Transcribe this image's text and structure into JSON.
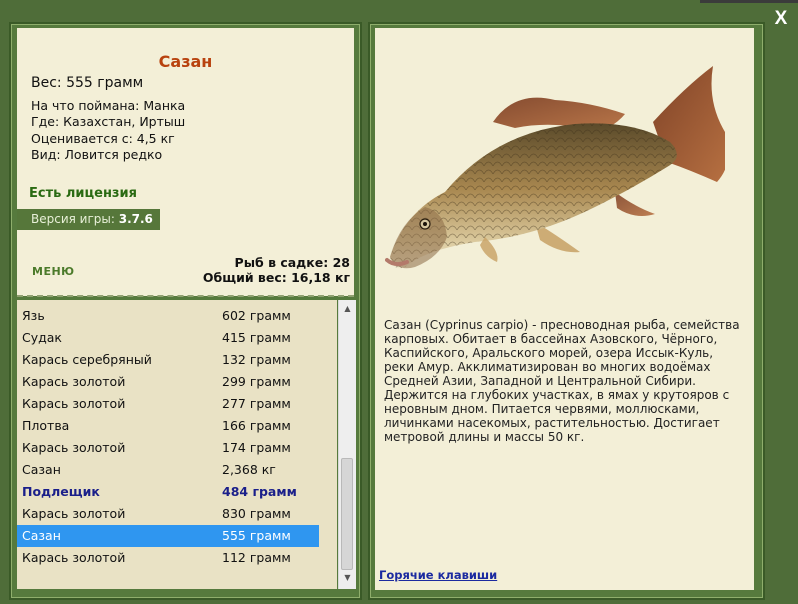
{
  "window": {
    "close_label": "X"
  },
  "catch": {
    "title": "Сазан",
    "weight": "Вес: 555 грамм",
    "bait": "На что поймана: Манка",
    "place": "Где: Казахстан, Иртыш",
    "value": "Оценивается с: 4,5 кг",
    "kind": "Вид: Ловится редко"
  },
  "license": "Есть лицензия",
  "version": {
    "label": "Версия игры: ",
    "value": "3.7.6"
  },
  "menu_label": "МЕНЮ",
  "stats": {
    "count": "Рыб в садке: 28",
    "total": "Общий вес: 16,18 кг"
  },
  "list": [
    {
      "name": "Язь",
      "weight": "602 грамм"
    },
    {
      "name": "Судак",
      "weight": "415 грамм"
    },
    {
      "name": "Карась серебряный",
      "weight": "132 грамм"
    },
    {
      "name": "Карась золотой",
      "weight": "299 грамм"
    },
    {
      "name": "Карась золотой",
      "weight": "277 грамм"
    },
    {
      "name": "Плотва",
      "weight": "166 грамм"
    },
    {
      "name": "Карась золотой",
      "weight": "174 грамм"
    },
    {
      "name": "Сазан",
      "weight": "2,368 кг"
    },
    {
      "name": "Подлещик",
      "weight": "484 грамм"
    },
    {
      "name": "Карась золотой",
      "weight": "830 грамм"
    },
    {
      "name": "Сазан",
      "weight": "555 грамм"
    },
    {
      "name": "Карась золотой",
      "weight": "112 грамм"
    }
  ],
  "description": "Сазан (Cyprinus carpio) - пресноводная рыба, семейства карповых. Обитает в бассейнах Азовского, Чёрного, Каспийского, Аральского морей, озера Иссык-Куль, реки Амур. Акклиматизирован во многих водоёмах Средней Азии, Западной и Центральной Сибири. Держится на глубоких участках, в ямах у крутояров с неровным дном. Питается червями, моллюсками, личинками насекомых, растительностью. Достигает метровой длины и массы 50 кг.",
  "hotkeys_label": "Горячие клавиши",
  "fish_image": "carp-image"
}
